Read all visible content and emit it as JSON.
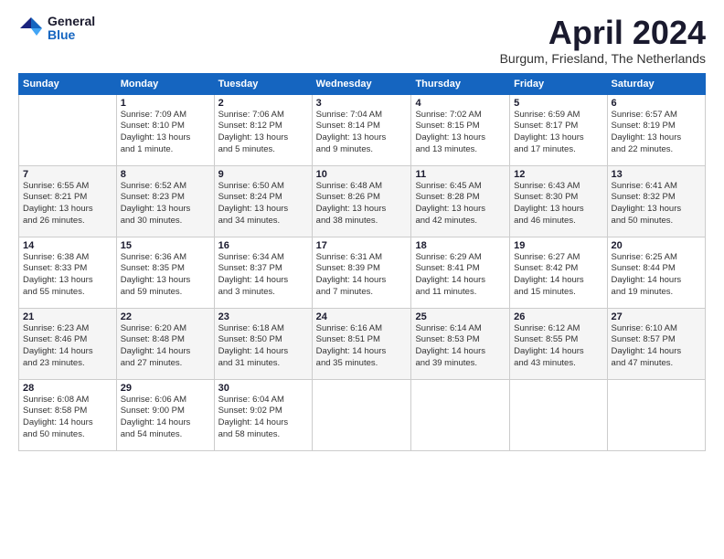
{
  "logo": {
    "general": "General",
    "blue": "Blue"
  },
  "header": {
    "month": "April 2024",
    "location": "Burgum, Friesland, The Netherlands"
  },
  "weekdays": [
    "Sunday",
    "Monday",
    "Tuesday",
    "Wednesday",
    "Thursday",
    "Friday",
    "Saturday"
  ],
  "weeks": [
    [
      {
        "day": "",
        "info": ""
      },
      {
        "day": "1",
        "info": "Sunrise: 7:09 AM\nSunset: 8:10 PM\nDaylight: 13 hours\nand 1 minute."
      },
      {
        "day": "2",
        "info": "Sunrise: 7:06 AM\nSunset: 8:12 PM\nDaylight: 13 hours\nand 5 minutes."
      },
      {
        "day": "3",
        "info": "Sunrise: 7:04 AM\nSunset: 8:14 PM\nDaylight: 13 hours\nand 9 minutes."
      },
      {
        "day": "4",
        "info": "Sunrise: 7:02 AM\nSunset: 8:15 PM\nDaylight: 13 hours\nand 13 minutes."
      },
      {
        "day": "5",
        "info": "Sunrise: 6:59 AM\nSunset: 8:17 PM\nDaylight: 13 hours\nand 17 minutes."
      },
      {
        "day": "6",
        "info": "Sunrise: 6:57 AM\nSunset: 8:19 PM\nDaylight: 13 hours\nand 22 minutes."
      }
    ],
    [
      {
        "day": "7",
        "info": "Sunrise: 6:55 AM\nSunset: 8:21 PM\nDaylight: 13 hours\nand 26 minutes."
      },
      {
        "day": "8",
        "info": "Sunrise: 6:52 AM\nSunset: 8:23 PM\nDaylight: 13 hours\nand 30 minutes."
      },
      {
        "day": "9",
        "info": "Sunrise: 6:50 AM\nSunset: 8:24 PM\nDaylight: 13 hours\nand 34 minutes."
      },
      {
        "day": "10",
        "info": "Sunrise: 6:48 AM\nSunset: 8:26 PM\nDaylight: 13 hours\nand 38 minutes."
      },
      {
        "day": "11",
        "info": "Sunrise: 6:45 AM\nSunset: 8:28 PM\nDaylight: 13 hours\nand 42 minutes."
      },
      {
        "day": "12",
        "info": "Sunrise: 6:43 AM\nSunset: 8:30 PM\nDaylight: 13 hours\nand 46 minutes."
      },
      {
        "day": "13",
        "info": "Sunrise: 6:41 AM\nSunset: 8:32 PM\nDaylight: 13 hours\nand 50 minutes."
      }
    ],
    [
      {
        "day": "14",
        "info": "Sunrise: 6:38 AM\nSunset: 8:33 PM\nDaylight: 13 hours\nand 55 minutes."
      },
      {
        "day": "15",
        "info": "Sunrise: 6:36 AM\nSunset: 8:35 PM\nDaylight: 13 hours\nand 59 minutes."
      },
      {
        "day": "16",
        "info": "Sunrise: 6:34 AM\nSunset: 8:37 PM\nDaylight: 14 hours\nand 3 minutes."
      },
      {
        "day": "17",
        "info": "Sunrise: 6:31 AM\nSunset: 8:39 PM\nDaylight: 14 hours\nand 7 minutes."
      },
      {
        "day": "18",
        "info": "Sunrise: 6:29 AM\nSunset: 8:41 PM\nDaylight: 14 hours\nand 11 minutes."
      },
      {
        "day": "19",
        "info": "Sunrise: 6:27 AM\nSunset: 8:42 PM\nDaylight: 14 hours\nand 15 minutes."
      },
      {
        "day": "20",
        "info": "Sunrise: 6:25 AM\nSunset: 8:44 PM\nDaylight: 14 hours\nand 19 minutes."
      }
    ],
    [
      {
        "day": "21",
        "info": "Sunrise: 6:23 AM\nSunset: 8:46 PM\nDaylight: 14 hours\nand 23 minutes."
      },
      {
        "day": "22",
        "info": "Sunrise: 6:20 AM\nSunset: 8:48 PM\nDaylight: 14 hours\nand 27 minutes."
      },
      {
        "day": "23",
        "info": "Sunrise: 6:18 AM\nSunset: 8:50 PM\nDaylight: 14 hours\nand 31 minutes."
      },
      {
        "day": "24",
        "info": "Sunrise: 6:16 AM\nSunset: 8:51 PM\nDaylight: 14 hours\nand 35 minutes."
      },
      {
        "day": "25",
        "info": "Sunrise: 6:14 AM\nSunset: 8:53 PM\nDaylight: 14 hours\nand 39 minutes."
      },
      {
        "day": "26",
        "info": "Sunrise: 6:12 AM\nSunset: 8:55 PM\nDaylight: 14 hours\nand 43 minutes."
      },
      {
        "day": "27",
        "info": "Sunrise: 6:10 AM\nSunset: 8:57 PM\nDaylight: 14 hours\nand 47 minutes."
      }
    ],
    [
      {
        "day": "28",
        "info": "Sunrise: 6:08 AM\nSunset: 8:58 PM\nDaylight: 14 hours\nand 50 minutes."
      },
      {
        "day": "29",
        "info": "Sunrise: 6:06 AM\nSunset: 9:00 PM\nDaylight: 14 hours\nand 54 minutes."
      },
      {
        "day": "30",
        "info": "Sunrise: 6:04 AM\nSunset: 9:02 PM\nDaylight: 14 hours\nand 58 minutes."
      },
      {
        "day": "",
        "info": ""
      },
      {
        "day": "",
        "info": ""
      },
      {
        "day": "",
        "info": ""
      },
      {
        "day": "",
        "info": ""
      }
    ]
  ]
}
